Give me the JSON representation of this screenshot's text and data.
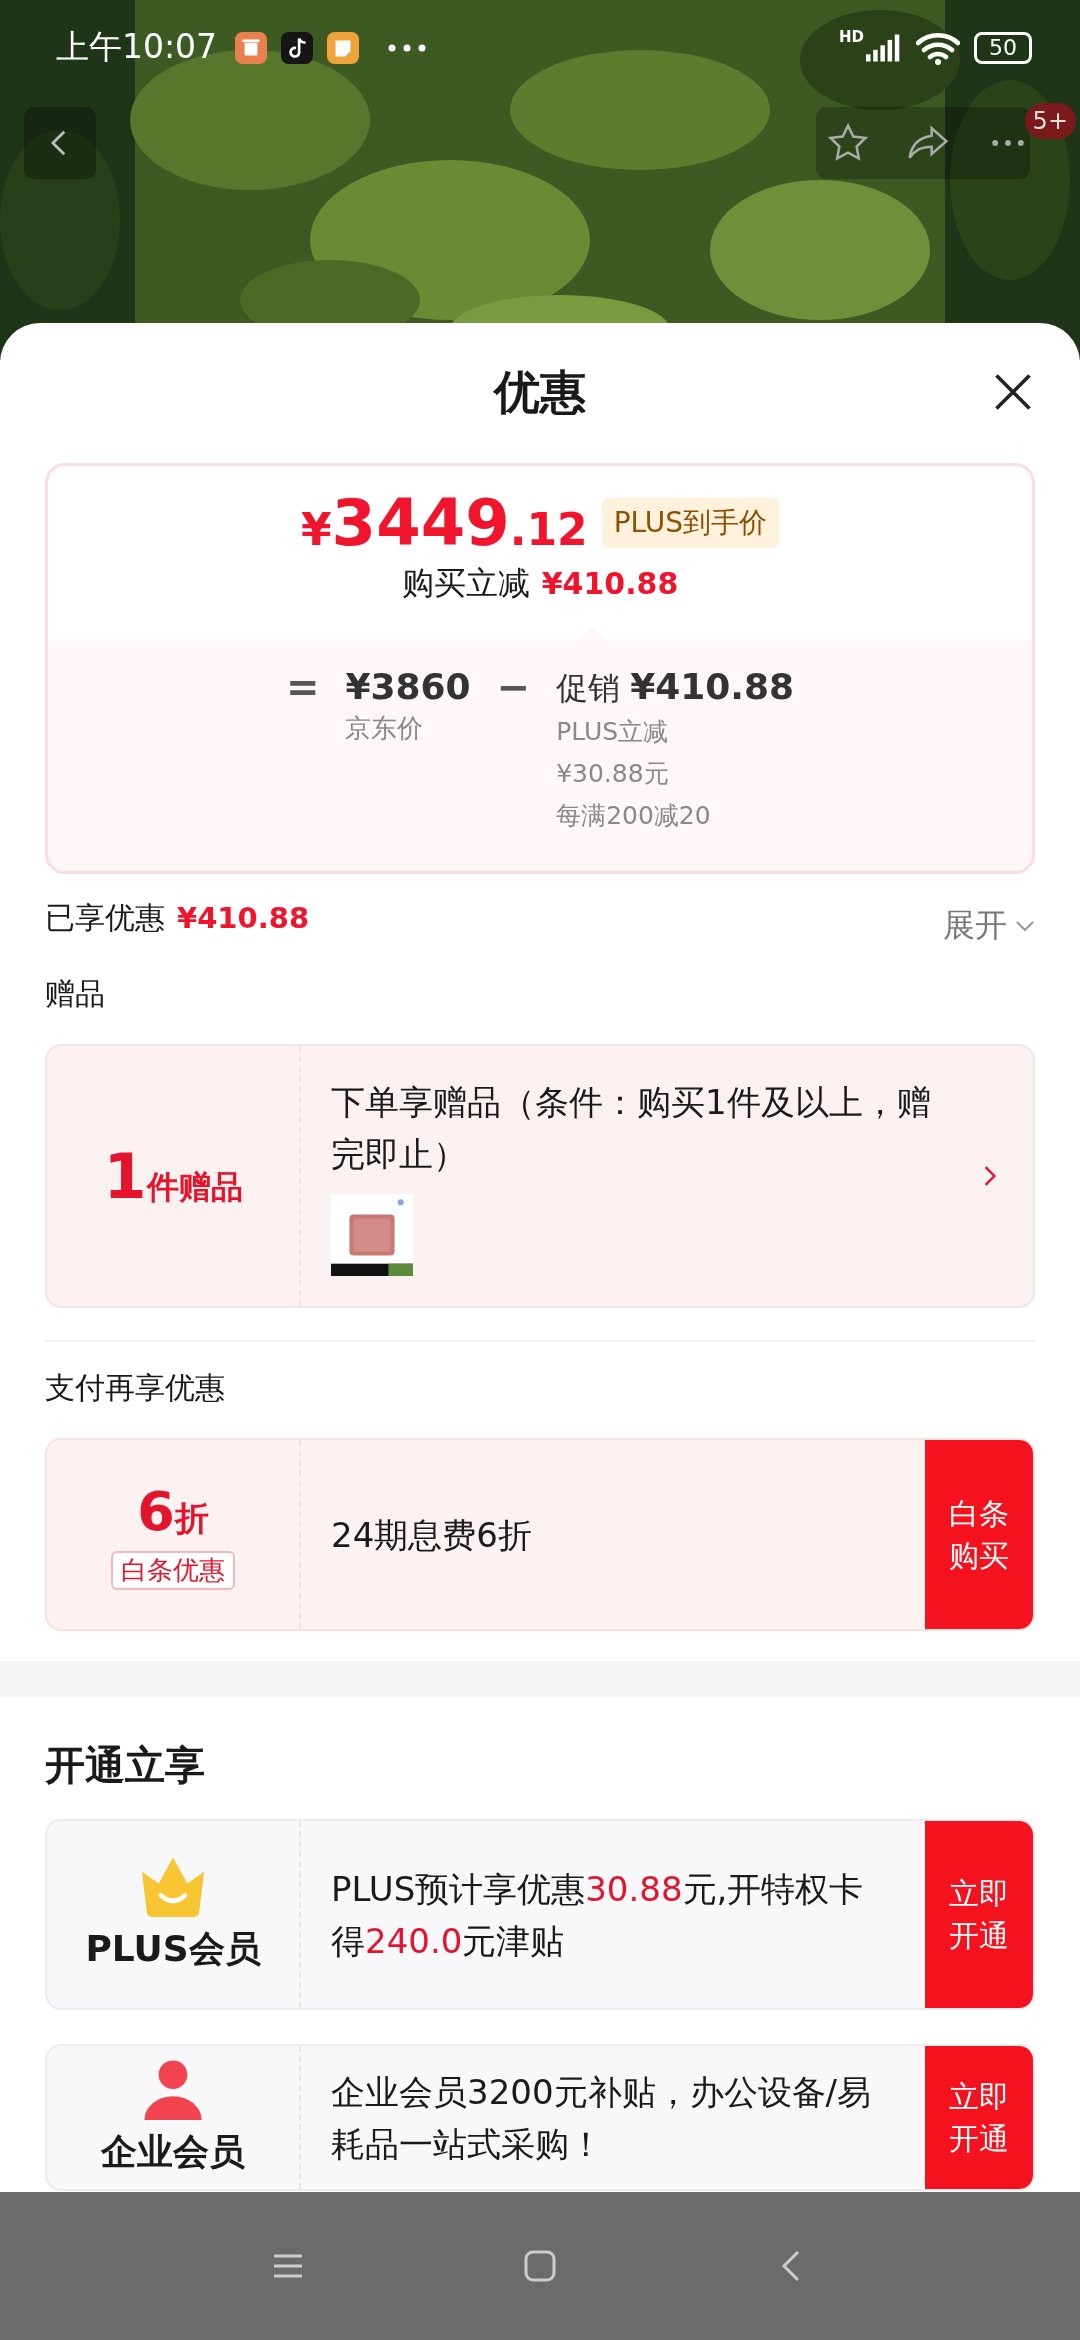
{
  "status_bar": {
    "time": "上午10:07",
    "network": "HD",
    "battery": "50"
  },
  "top_nav": {
    "badge": "5+"
  },
  "sheet": {
    "title": "优惠"
  },
  "price_card": {
    "price_symbol": "¥",
    "price_integer": "3449",
    "price_decimal": ".12",
    "price_tag": "PLUS到手价",
    "saving_label": "购买立减",
    "saving_amount": "¥410.88",
    "breakdown": {
      "equals": "=",
      "base_amount": "¥3860",
      "base_label": "京东价",
      "minus": "−",
      "promo_label": "促销",
      "promo_amount": "¥410.88",
      "details": [
        "PLUS立减",
        "¥30.88元",
        "每满200减20"
      ]
    }
  },
  "enjoyed": {
    "label": "已享优惠",
    "amount": "¥410.88",
    "toggle": "展开"
  },
  "gifts": {
    "heading": "赠品",
    "count": "1",
    "count_unit": "件赠品",
    "description": "下单享赠品（条件：购买1件及以上，赠完即止）"
  },
  "payment": {
    "heading": "支付再享优惠",
    "offers": [
      {
        "discount": "6",
        "discount_unit": "折",
        "tag": "白条优惠",
        "text": "24期息费6折",
        "action": "白条购买"
      }
    ]
  },
  "membership": {
    "heading": "开通立享",
    "offers": [
      {
        "kind": "plus",
        "name": "PLUS会员",
        "parts": [
          {
            "text": "PLUS预计享优惠",
            "highlight": false
          },
          {
            "text": "30.88",
            "highlight": true
          },
          {
            "text": "元,开特权卡得",
            "highlight": false
          },
          {
            "text": "240.0",
            "highlight": true
          },
          {
            "text": "元津贴",
            "highlight": false
          }
        ],
        "action": "立即开通"
      },
      {
        "kind": "enterprise",
        "name": "企业会员",
        "parts": [
          {
            "text": "企业会员3200元补贴，办公设备/易耗品一站式采购！",
            "highlight": false
          }
        ],
        "action": "立即开通"
      }
    ]
  }
}
